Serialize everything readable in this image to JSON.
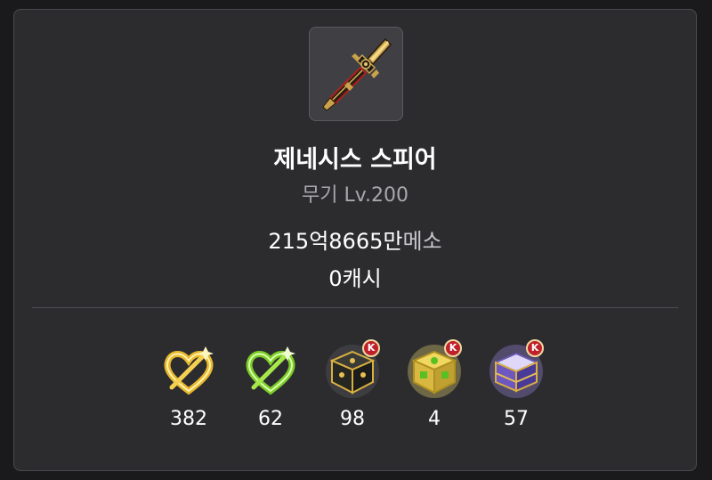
{
  "item": {
    "name": "제네시스 스피어",
    "type_level": "무기 Lv.200",
    "icon": "spear-icon"
  },
  "price": {
    "amount": "215억8665만",
    "unit": "메소"
  },
  "cash": {
    "text": "0캐시"
  },
  "materials": [
    {
      "icon": "gold-heart-icon",
      "count": "382"
    },
    {
      "icon": "green-heart-icon",
      "count": "62"
    },
    {
      "icon": "black-cube-icon",
      "count": "98"
    },
    {
      "icon": "additional-cube-icon",
      "count": "4"
    },
    {
      "icon": "purple-cube-icon",
      "count": "57"
    }
  ],
  "badge_letter": "K"
}
